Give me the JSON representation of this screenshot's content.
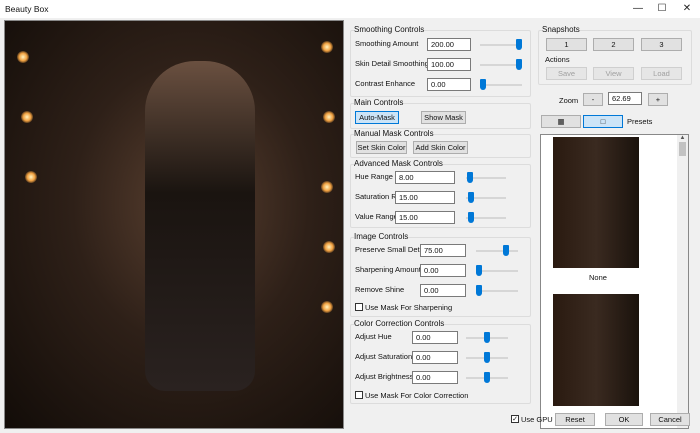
{
  "window": {
    "title": "Beauty Box",
    "minimize": "—",
    "maximize": "☐",
    "close": "✕"
  },
  "smoothing": {
    "title": "Smoothing Controls",
    "rows": [
      {
        "label": "Smoothing Amount",
        "value": "200.00",
        "level": 1.0
      },
      {
        "label": "Skin Detail Smoothing",
        "value": "100.00",
        "level": 1.0
      },
      {
        "label": "Contrast Enhance",
        "value": "0.00",
        "level": 0.0
      }
    ]
  },
  "main": {
    "title": "Main Controls",
    "auto_mask": "Auto-Mask",
    "show_mask": "Show Mask"
  },
  "manual": {
    "title": "Manual Mask Controls",
    "set_skin": "Set Skin Color",
    "add_skin": "Add Skin Color"
  },
  "advanced": {
    "title": "Advanced Mask Controls",
    "rows": [
      {
        "label": "Hue Range",
        "value": "8.00",
        "level": 0.03
      },
      {
        "label": "Saturation Range",
        "value": "15.00",
        "level": 0.05
      },
      {
        "label": "Value Range",
        "value": "15.00",
        "level": 0.05
      }
    ]
  },
  "image": {
    "title": "Image Controls",
    "rows": [
      {
        "label": "Preserve Small Detail",
        "value": "75.00",
        "level": 0.75
      },
      {
        "label": "Sharpening Amount",
        "value": "0.00",
        "level": 0.0
      },
      {
        "label": "Remove Shine",
        "value": "0.00",
        "level": 0.0
      }
    ],
    "mask_sharpening": "Use Mask For Sharpening"
  },
  "color": {
    "title": "Color Correction Controls",
    "rows": [
      {
        "label": "Adjust Hue",
        "value": "0.00",
        "level": 0.5
      },
      {
        "label": "Adjust Saturation",
        "value": "0.00",
        "level": 0.5
      },
      {
        "label": "Adjust Brightness",
        "value": "0.00",
        "level": 0.5
      }
    ],
    "mask_color": "Use Mask For Color Correction"
  },
  "snapshots": {
    "title": "Snapshots",
    "buttons": [
      "1",
      "2",
      "3"
    ],
    "actions_title": "Actions",
    "actions": [
      "Save",
      "View",
      "Load"
    ]
  },
  "zoom": {
    "label": "Zoom",
    "minus": "-",
    "value": "62.69",
    "plus": "+"
  },
  "presets": {
    "label": "Presets",
    "grid_icon": "grid-view-icon",
    "single_icon": "single-view-icon",
    "items": [
      {
        "name": "None"
      },
      {
        "name": ""
      }
    ]
  },
  "footer": {
    "use_gpu": "Use GPU",
    "use_gpu_checked": true,
    "reset": "Reset",
    "ok": "OK",
    "cancel": "Cancel"
  },
  "accent": "#0078d7"
}
